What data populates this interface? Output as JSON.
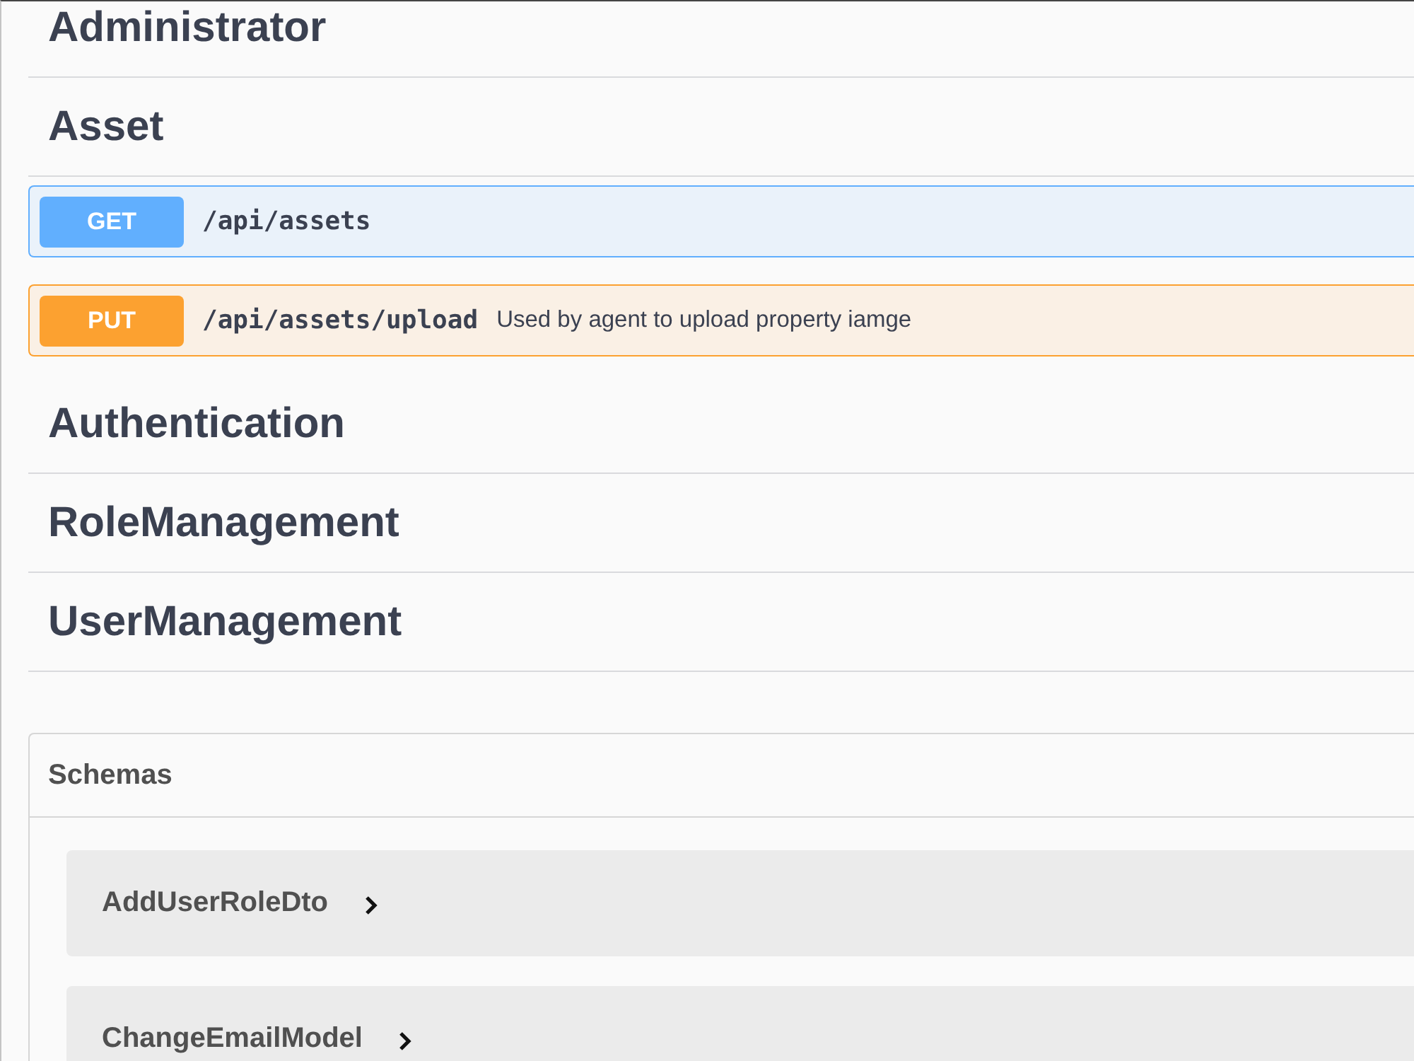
{
  "tags": [
    {
      "name": "Administrator"
    },
    {
      "name": "Asset",
      "operations": [
        {
          "method": "GET",
          "color": "#61affe",
          "path": "/api/assets"
        },
        {
          "method": "PUT",
          "color": "#fca130",
          "path": "/api/assets/upload",
          "description": "Used by agent to upload property iamge"
        }
      ]
    },
    {
      "name": "Authentication"
    },
    {
      "name": "RoleManagement"
    },
    {
      "name": "UserManagement"
    }
  ],
  "schemas": {
    "title": "Schemas",
    "models": [
      {
        "name": "AddUserRoleDto",
        "expanded": false
      },
      {
        "name": "ChangeEmailModel",
        "expanded": false
      }
    ]
  }
}
